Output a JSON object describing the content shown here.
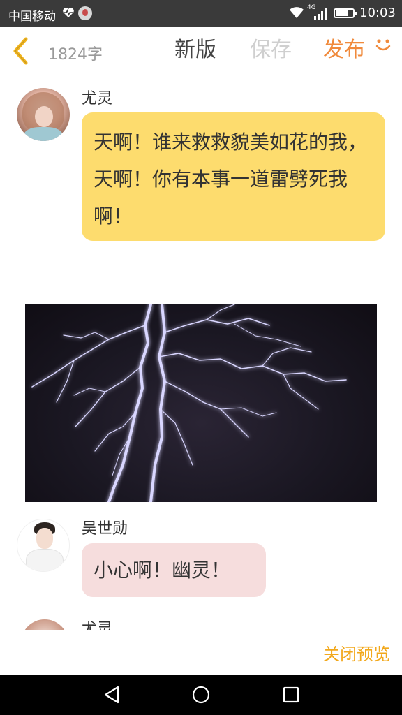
{
  "status_bar": {
    "carrier": "中国移动",
    "network": "4G",
    "time": "10:03"
  },
  "toolbar": {
    "word_count": "1824字",
    "new_version": "新版",
    "save": "保存",
    "publish": "发布",
    "accent_color": "#f08a3c",
    "disabled_color": "#cfcfcf"
  },
  "messages": [
    {
      "name": "尤灵",
      "text": "天啊！谁来救救貌美如花的我，天啊！你有本事一道雷劈死我啊！",
      "bubble_color": "#fddc6e"
    },
    {
      "name": "吴世勋",
      "text": "小心啊！幽灵！",
      "bubble_color": "#f6dddd"
    },
    {
      "name": "尤灵"
    }
  ],
  "footer": {
    "close_preview": "关闭预览",
    "color": "#f2a81c"
  },
  "icons": [
    "chevron-left-icon",
    "smile-icon",
    "heart-monitor-icon",
    "wifi-icon",
    "signal-icon",
    "battery-icon",
    "nav-back-icon",
    "nav-home-icon",
    "nav-recent-icon"
  ]
}
